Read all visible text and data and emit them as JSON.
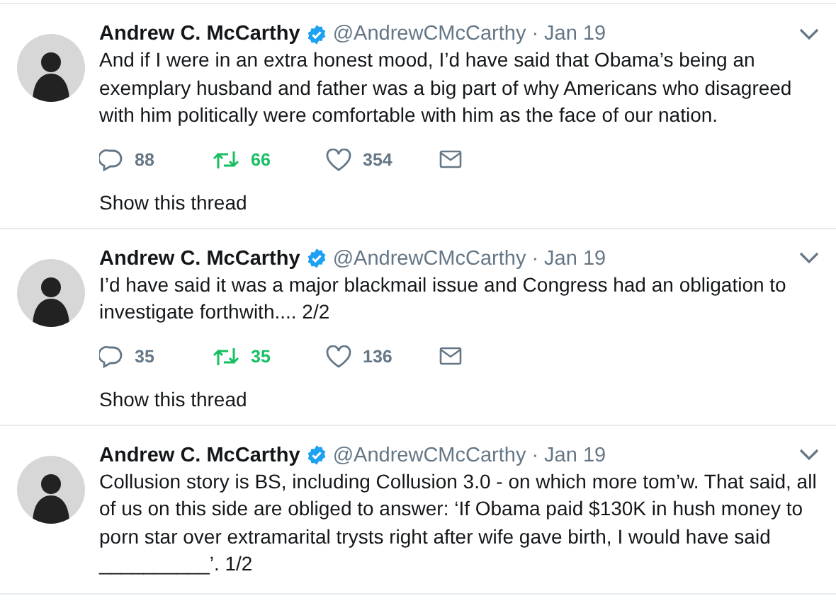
{
  "tweets": [
    {
      "name": "Andrew C. McCarthy",
      "verified": true,
      "handle": "@AndrewCMcCarthy",
      "date": "· Jan 19",
      "text": "And if I were in an extra honest mood, I’d have said that Obama’s being an\nexemplary husband and father was a big part of why Americans who disagreed\nwith him politically were comfortable with him as the face of our nation.",
      "actions": {
        "replies": "88",
        "retweets": "66",
        "retweeted": true,
        "likes": "354"
      },
      "thread_link": "Show this thread"
    },
    {
      "name": "Andrew C. McCarthy",
      "verified": true,
      "handle": "@AndrewCMcCarthy",
      "date": "· Jan 19",
      "text": "I’d have said it was a major blackmail issue and Congress had an obligation to\ninvestigate forthwith.... 2/2",
      "actions": {
        "replies": "35",
        "retweets": "35",
        "retweeted": true,
        "likes": "136"
      },
      "thread_link": "Show this thread"
    },
    {
      "name": "Andrew C. McCarthy",
      "verified": true,
      "handle": "@AndrewCMcCarthy",
      "date": "· Jan 19",
      "text": "Collusion story is BS, including Collusion 3.0 - on which more tom’w. That said, all\nof us on this side are obliged to answer: ‘If Obama paid $130K in hush money to\nporn star over extramarital trysts right after wife gave birth, I would have said\n__________’. 1/2"
    }
  ]
}
